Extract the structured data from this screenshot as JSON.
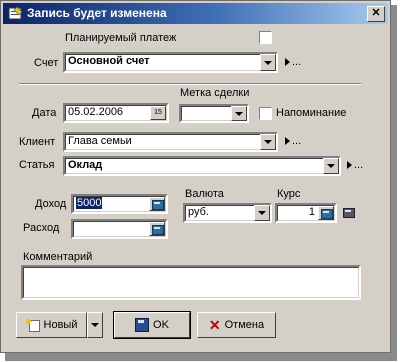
{
  "window": {
    "title": "Запись будет изменена",
    "close_glyph": "✕"
  },
  "form": {
    "planned_label": "Планируемый платеж",
    "account": {
      "label": "Счет",
      "value": "Основной счет",
      "more": "..."
    },
    "deal_mark_label": "Метка сделки",
    "date": {
      "label": "Дата",
      "value": "05.02.2006",
      "calendar_glyph": "15"
    },
    "reminder_label": "Напоминание",
    "client": {
      "label": "Клиент",
      "value": "Глава семьи",
      "more": "..."
    },
    "article": {
      "label": "Статья",
      "value": "Оклад",
      "more": "..."
    },
    "income": {
      "label": "Доход",
      "value": "5000"
    },
    "expense": {
      "label": "Расход",
      "value": ""
    },
    "currency": {
      "label": "Валюта",
      "value": "руб."
    },
    "rate": {
      "label": "Курс",
      "value": "1"
    },
    "comment_label": "Комментарий",
    "comment_value": ""
  },
  "buttons": {
    "new": "Новый",
    "ok": "OK",
    "cancel": "Отмена"
  },
  "icons": {
    "title": "form-icon",
    "dropdown": "chevron-down-icon",
    "more": "triangle-right-icon",
    "calc": "calculator-icon",
    "ok": "floppy-disk-icon",
    "cancel": "red-x-icon",
    "new": "new-document-icon"
  }
}
